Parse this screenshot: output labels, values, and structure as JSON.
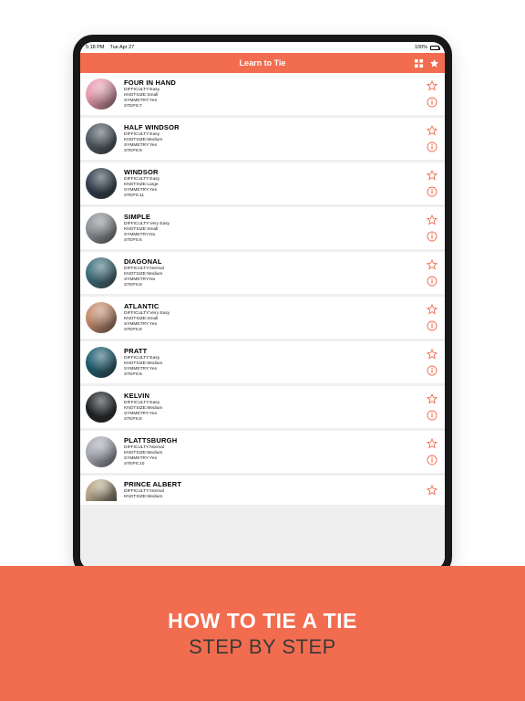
{
  "statusbar": {
    "time": "5:18 PM",
    "date": "Tue Apr 27",
    "battery": "100%"
  },
  "navbar": {
    "title": "Learn to Tie"
  },
  "labels": {
    "difficulty": "DIFFICULTY:",
    "knotsize": "KNOTSIZE:",
    "symmetry": "SYMMETRY:",
    "steps": "STEPS:"
  },
  "ties": [
    {
      "name": "FOUR IN HAND",
      "difficulty": "Easy",
      "knotsize": "Small",
      "symmetry": "Yes",
      "steps": "7",
      "thumb": "#e79aae"
    },
    {
      "name": "HALF WINDSOR",
      "difficulty": "Easy",
      "knotsize": "Medium",
      "symmetry": "Yes",
      "steps": "9",
      "thumb": "#4a5560"
    },
    {
      "name": "WINDSOR",
      "difficulty": "Easy",
      "knotsize": "Large",
      "symmetry": "Yes",
      "steps": "11",
      "thumb": "#2d3b4a"
    },
    {
      "name": "SIMPLE",
      "difficulty": "Very Easy",
      "knotsize": "Small",
      "symmetry": "No",
      "steps": "6",
      "thumb": "#8b8f93"
    },
    {
      "name": "DIAGONAL",
      "difficulty": "Normal",
      "knotsize": "Medium",
      "symmetry": "No",
      "steps": "8",
      "thumb": "#3a6b78"
    },
    {
      "name": "ATLANTIC",
      "difficulty": "Very Easy",
      "knotsize": "Small",
      "symmetry": "Yes",
      "steps": "8",
      "thumb": "#c48a6a"
    },
    {
      "name": "PRATT",
      "difficulty": "Easy",
      "knotsize": "Medium",
      "symmetry": "Yes",
      "steps": "8",
      "thumb": "#1a5a6e"
    },
    {
      "name": "KELVIN",
      "difficulty": "Easy",
      "knotsize": "Medium",
      "symmetry": "Yes",
      "steps": "8",
      "thumb": "#1c1f23"
    },
    {
      "name": "PLATTSBURGH",
      "difficulty": "Normal",
      "knotsize": "Medium",
      "symmetry": "Yes",
      "steps": "10",
      "thumb": "#a7a9b5"
    },
    {
      "name": "PRINCE ALBERT",
      "difficulty": "Normal",
      "knotsize": "Medium",
      "symmetry": "",
      "steps": "",
      "thumb": "#b9a98c"
    }
  ],
  "footer": {
    "line1": "HOW TO TIE A TIE",
    "line2": "STEP BY STEP"
  }
}
